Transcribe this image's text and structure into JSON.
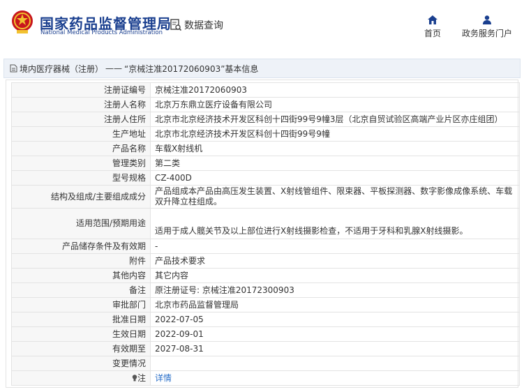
{
  "header": {
    "title_cn": "国家药品监督管理局",
    "title_en": "National Medical Products Administration",
    "query_label": "数据查询",
    "nav": [
      {
        "label": "首页",
        "icon": "home-icon"
      },
      {
        "label": "政务服务门户",
        "icon": "user-icon"
      }
    ],
    "colors": {
      "brand": "#1a3f8f",
      "emblem": "#c8161d"
    }
  },
  "breadcrumb": {
    "part1": "境内医疗器械（注册）",
    "sep": "——",
    "part2": "“京械注准20172060903”基本信息"
  },
  "record": [
    {
      "key": "注册证编号",
      "value": "京械注准20172060903"
    },
    {
      "key": "注册人名称",
      "value": "北京万东鼎立医疗设备有限公司"
    },
    {
      "key": "注册人住所",
      "value": "北京市北京经济技术开发区科创十四街99号9幢3层（北京自贸试验区高端产业片区亦庄组团）"
    },
    {
      "key": "生产地址",
      "value": "北京市北京经济技术开发区科创十四街99号9幢"
    },
    {
      "key": "产品名称",
      "value": "车载X射线机"
    },
    {
      "key": "管理类别",
      "value": "第二类"
    },
    {
      "key": "型号规格",
      "value": "CZ-400D"
    },
    {
      "key": "结构及组成/主要组成成分",
      "value": "产品组成本产品由高压发生装置、X射线管组件、限束器、平板探测器、数字影像成像系统、车载双升降立柱组成。"
    },
    {
      "key": "适用范围/预期用途",
      "value": "适用于成人髋关节及以上部位进行X射线摄影检查，不适用于牙科和乳腺X射线摄影。"
    },
    {
      "key": "产品储存条件及有效期",
      "value": "-"
    },
    {
      "key": "附件",
      "value": "产品技术要求"
    },
    {
      "key": "其他内容",
      "value": "其它内容"
    },
    {
      "key": "备注",
      "value": "原注册证号: 京械注准20172300903"
    },
    {
      "key": "审批部门",
      "value": "北京市药品监督管理局"
    },
    {
      "key": "批准日期",
      "value": "2022-07-05"
    },
    {
      "key": "生效日期",
      "value": "2022-09-01"
    },
    {
      "key": "有效期至",
      "value": "2027-08-31"
    },
    {
      "key": "变更情况",
      "value": ""
    }
  ],
  "note": {
    "key": "注",
    "value": "详情",
    "icon": "bulb-icon"
  }
}
